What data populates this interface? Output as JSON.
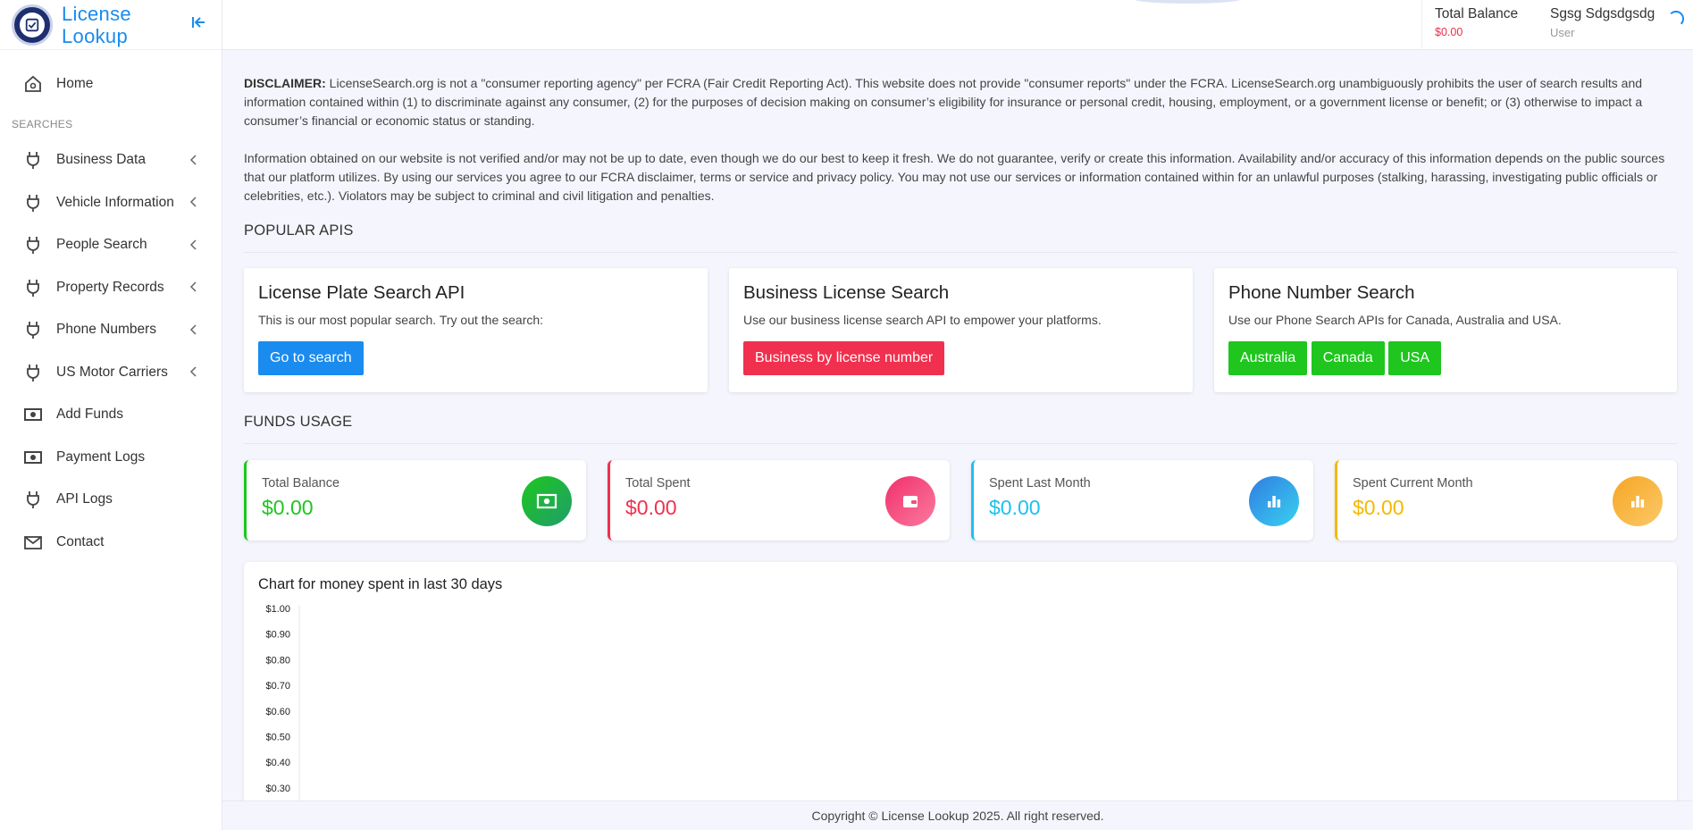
{
  "brand": {
    "name_line1": "License",
    "name_line2": "Lookup"
  },
  "sidebar": {
    "home": "Home",
    "section_label": "SEARCHES",
    "items": [
      {
        "label": "Business Data",
        "icon": "plug-icon",
        "expandable": true
      },
      {
        "label": "Vehicle Information",
        "icon": "plug-icon",
        "expandable": true
      },
      {
        "label": "People Search",
        "icon": "plug-icon",
        "expandable": true
      },
      {
        "label": "Property Records",
        "icon": "plug-icon",
        "expandable": true
      },
      {
        "label": "Phone Numbers",
        "icon": "plug-icon",
        "expandable": true
      },
      {
        "label": "US Motor Carriers",
        "icon": "plug-icon",
        "expandable": true
      },
      {
        "label": "Add Funds",
        "icon": "money-icon",
        "expandable": false
      },
      {
        "label": "Payment Logs",
        "icon": "money-icon",
        "expandable": false
      },
      {
        "label": "API Logs",
        "icon": "plug-icon",
        "expandable": false
      },
      {
        "label": "Contact",
        "icon": "envelope-icon",
        "expandable": false
      }
    ]
  },
  "topbar": {
    "balance_title": "Total Balance",
    "balance_value": "$0.00",
    "user_name": "Sgsg Sdgsdgsdg",
    "user_role": "User"
  },
  "disclaimer": {
    "lead": "DISCLAIMER:",
    "text1": " LicenseSearch.org is not a \"consumer reporting agency\" per FCRA (Fair Credit Reporting Act). This website does not provide \"consumer reports\" under the FCRA. LicenseSearch.org unambiguously prohibits the user of search results and information contained within (1) to discriminate against any consumer, (2) for the purposes of decision making on consumer’s eligibility for insurance or personal credit, housing, employment, or a government license or benefit; or (3) otherwise to impact a consumer’s financial or economic status or standing.",
    "text2": "Information obtained on our website is not verified and/or may not be up to date, even though we do our best to keep it fresh. We do not guarantee, verify or create this information. Availability and/or accuracy of this information depends on the public sources that our platform utilizes. By using our services you agree to our FCRA disclaimer, terms or service and privacy policy. You may not use our services or information contained within for an unlawful purposes (stalking, harassing, investigating public officials or celebrities, etc.). Violators may be subject to criminal and civil litigation and penalties."
  },
  "popular_apis": {
    "title": "POPULAR APIS",
    "cards": [
      {
        "title": "License Plate Search API",
        "desc": "This is our most popular search. Try out the search:",
        "buttons": [
          "Go to search"
        ]
      },
      {
        "title": "Business License Search",
        "desc": "Use our business license search API to empower your platforms.",
        "buttons": [
          "Business by license number"
        ]
      },
      {
        "title": "Phone Number Search",
        "desc": "Use our Phone Search APIs for Canada, Australia and USA.",
        "buttons": [
          "Australia",
          "Canada",
          "USA"
        ]
      }
    ]
  },
  "funds_usage": {
    "title": "FUNDS USAGE",
    "stats": [
      {
        "label": "Total Balance",
        "value": "$0.00",
        "color": "#1ec61e",
        "icon": "money-icon"
      },
      {
        "label": "Total Spent",
        "value": "$0.00",
        "color": "#f0304e",
        "icon": "wallet-icon"
      },
      {
        "label": "Spent Last Month",
        "value": "$0.00",
        "color": "#1ec0ef",
        "icon": "bar-chart-icon"
      },
      {
        "label": "Spent Current Month",
        "value": "$0.00",
        "color": "#f5b800",
        "icon": "bar-chart-icon"
      }
    ]
  },
  "chart_data": {
    "type": "line",
    "title": "Chart for money spent in last 30 days",
    "y_ticks": [
      "$1.00",
      "$0.90",
      "$0.80",
      "$0.70",
      "$0.60",
      "$0.50",
      "$0.40",
      "$0.30"
    ],
    "ylim": [
      0.3,
      1.0
    ],
    "series": []
  },
  "footer": {
    "text": "Copyright © License Lookup 2025. All right reserved."
  },
  "colors": {
    "accent": "#1a8bef",
    "danger": "#f0304e",
    "success": "#1ec61e",
    "info": "#1ec0ef",
    "warning": "#f5b800"
  }
}
